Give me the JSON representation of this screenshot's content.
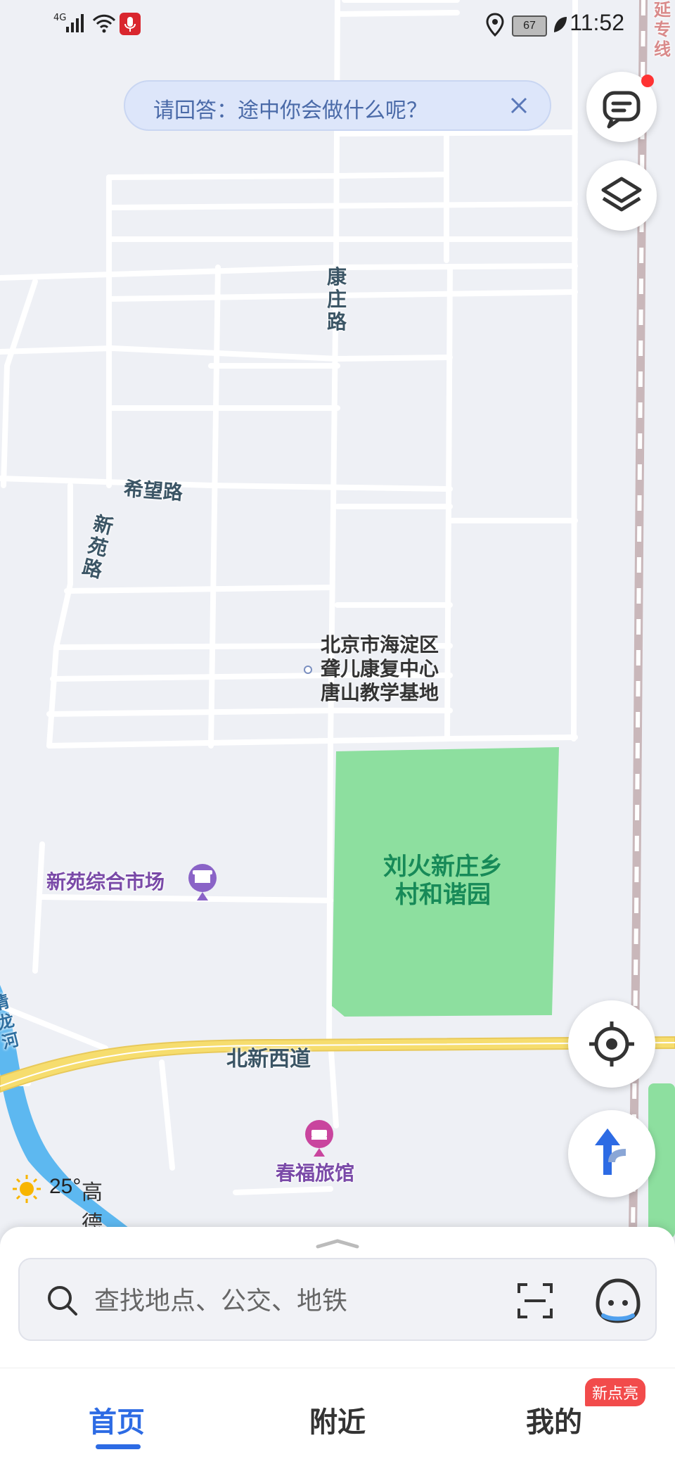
{
  "status_bar": {
    "network": "4G",
    "battery": "67",
    "time": "11:52"
  },
  "prompt": {
    "text": "请回答：途中你会做什么呢？"
  },
  "map": {
    "roads": {
      "kangzhuang": "康庄路",
      "xiwang": "希望路",
      "xinyuan": "新苑路",
      "beixinxi": "北新西道",
      "river": "清龙河",
      "rail": "延专线"
    },
    "pois": {
      "institute": [
        "北京市海淀区",
        "聋儿康复中心",
        "唐山教学基地"
      ],
      "market": "新苑综合市场",
      "park": [
        "刘火新庄乡",
        "村和谐园"
      ],
      "hotel": "春福旅馆"
    },
    "colors": {
      "park": "#8ddf9f",
      "road_major": "#f6dd6e",
      "river": "#5db8f0",
      "background": "#eef0f5",
      "accent": "#2d6be4"
    }
  },
  "weather": {
    "temperature": "25°",
    "brand": "高德地图"
  },
  "search": {
    "placeholder": "查找地点、公交、地铁"
  },
  "tabs": {
    "home": "首页",
    "nearby": "附近",
    "mine": "我的",
    "mine_badge": "新点亮"
  }
}
